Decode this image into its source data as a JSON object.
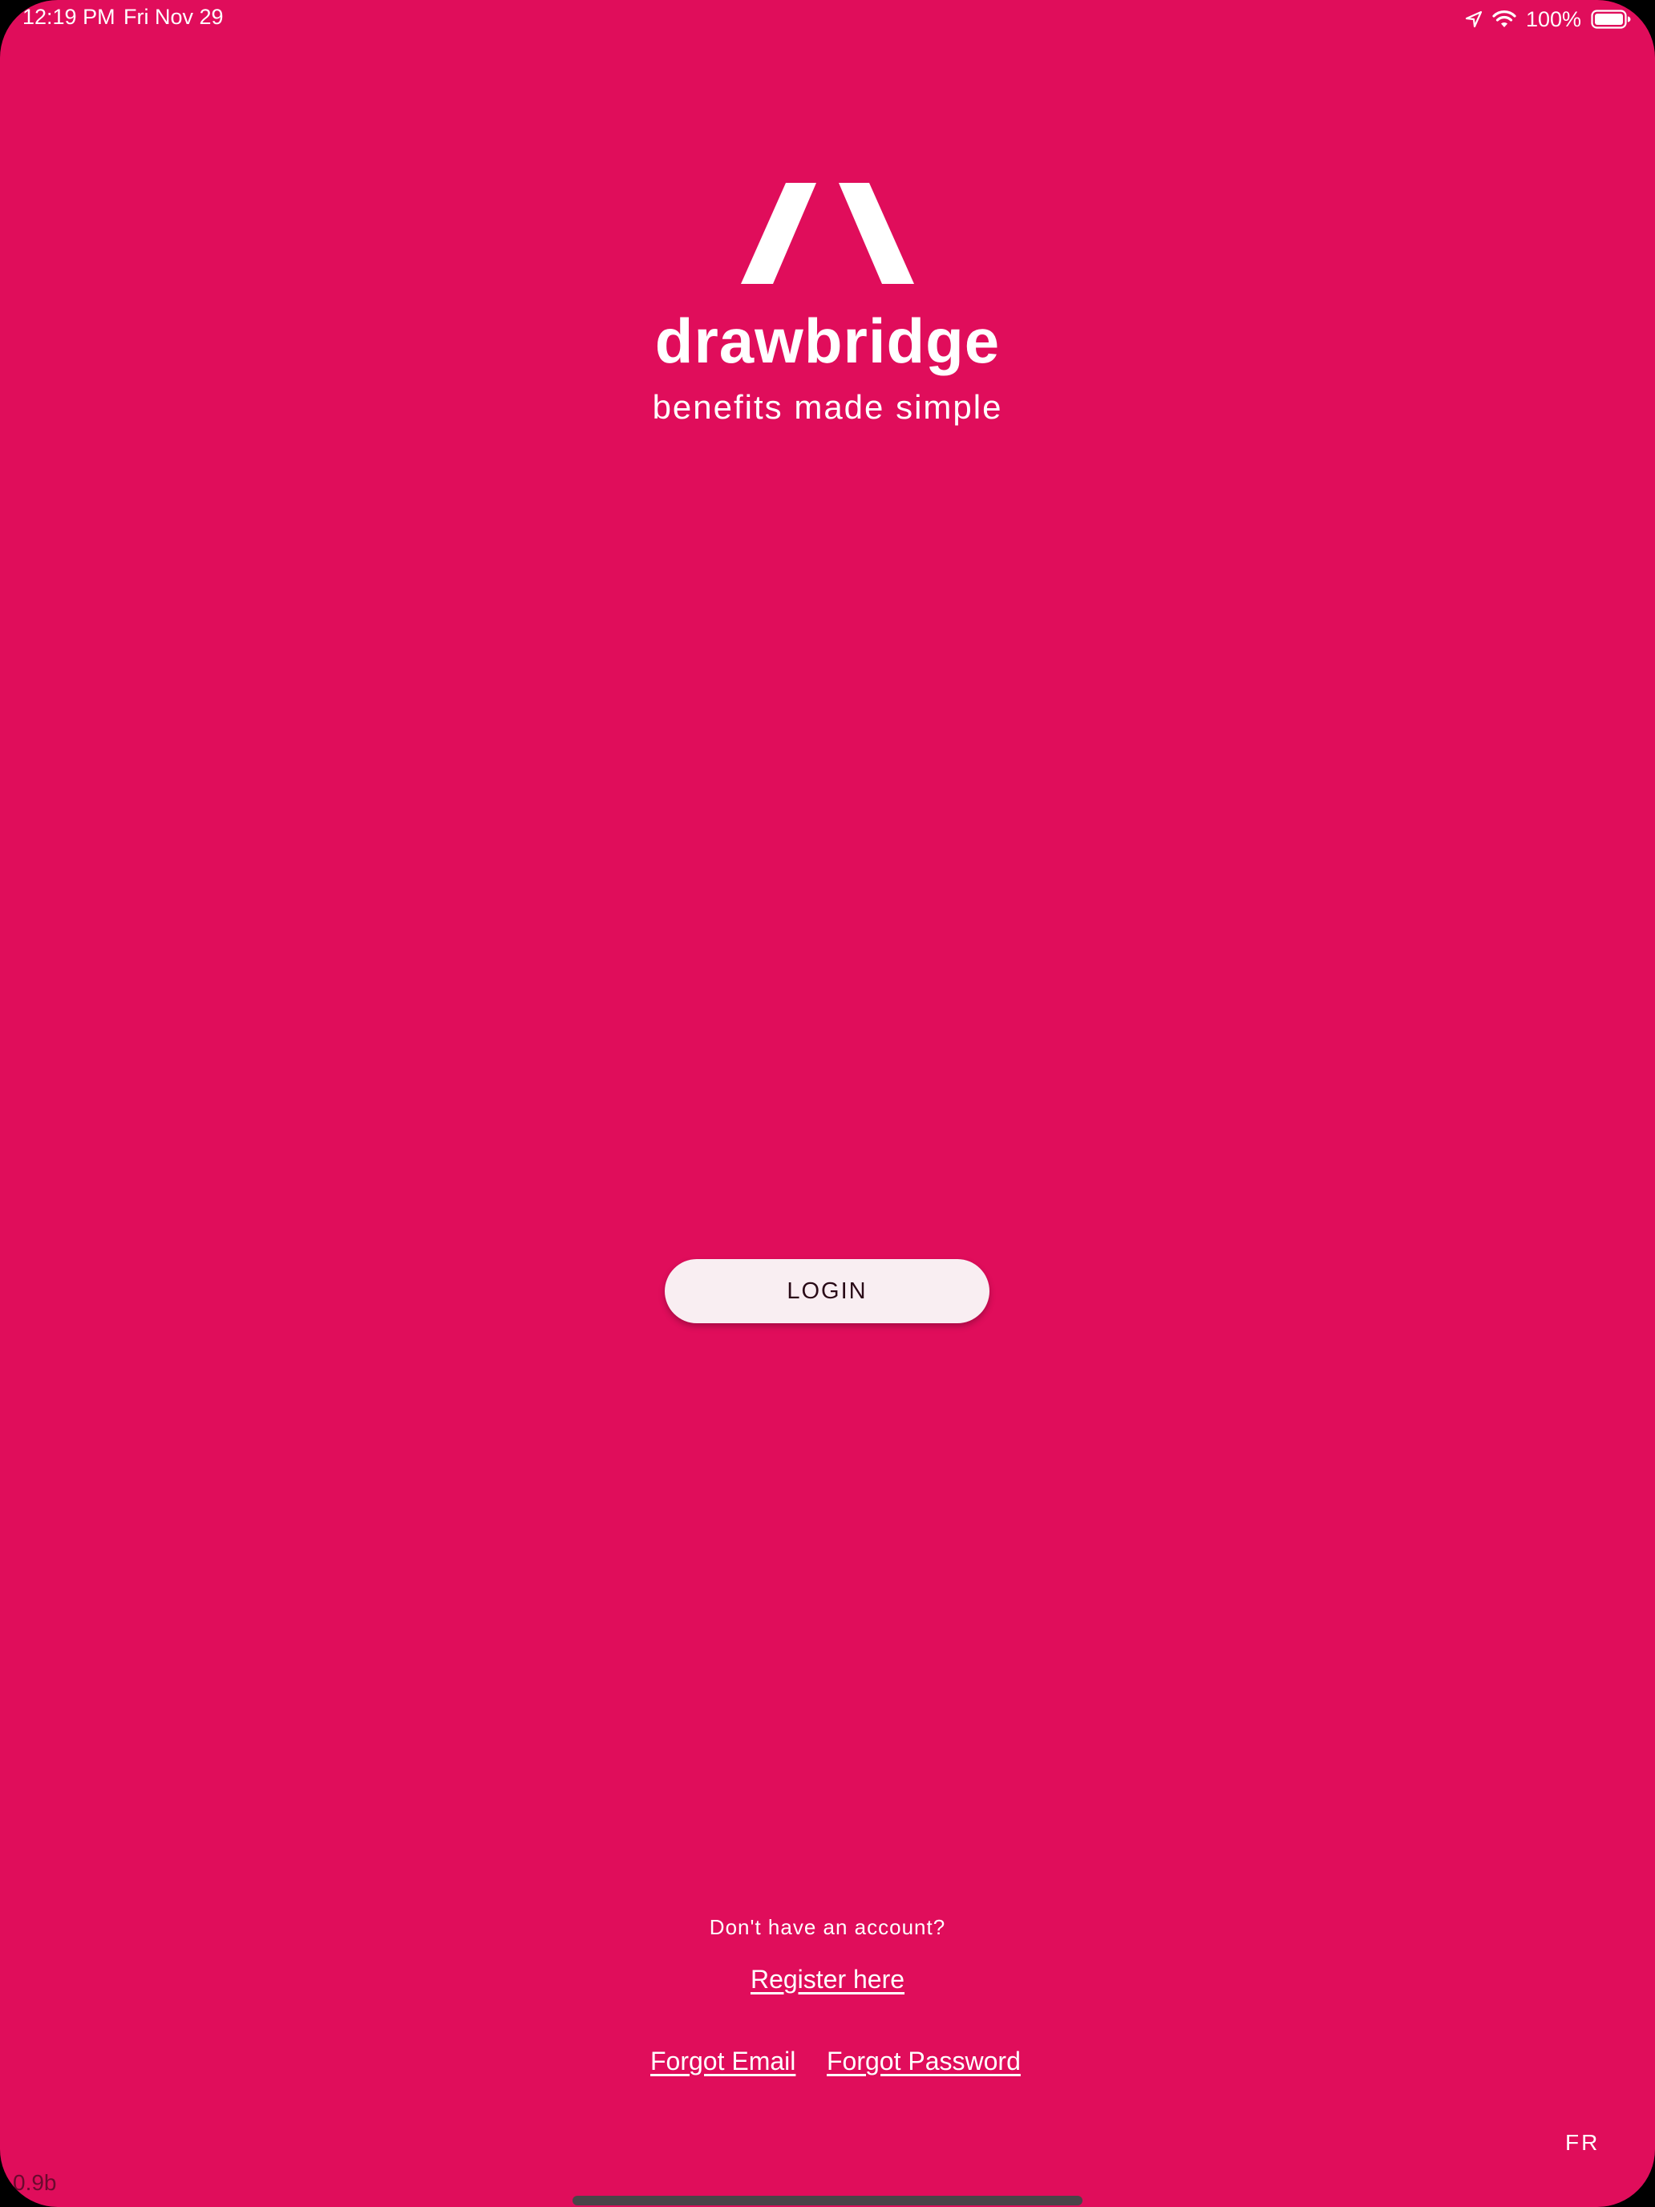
{
  "status_bar": {
    "time": "12:19 PM",
    "date": "Fri Nov 29",
    "battery_percent": "100%",
    "icons": [
      "location-arrow-icon",
      "wifi-icon",
      "battery-icon"
    ]
  },
  "brand": {
    "logo_icon": "drawbridge-logo-icon",
    "name": "drawbridge",
    "tagline": "benefits made simple"
  },
  "login": {
    "label": "LOGIN"
  },
  "account": {
    "prompt": "Don't have an account?",
    "register_label": "Register here"
  },
  "recovery": {
    "forgot_email_label": "Forgot Email",
    "forgot_password_label": "Forgot Password"
  },
  "language_toggle": "FR",
  "version": "0.9b",
  "colors": {
    "background": "#E00D5B",
    "button_background": "#F9EEF2",
    "text": "#FFFFFF"
  }
}
